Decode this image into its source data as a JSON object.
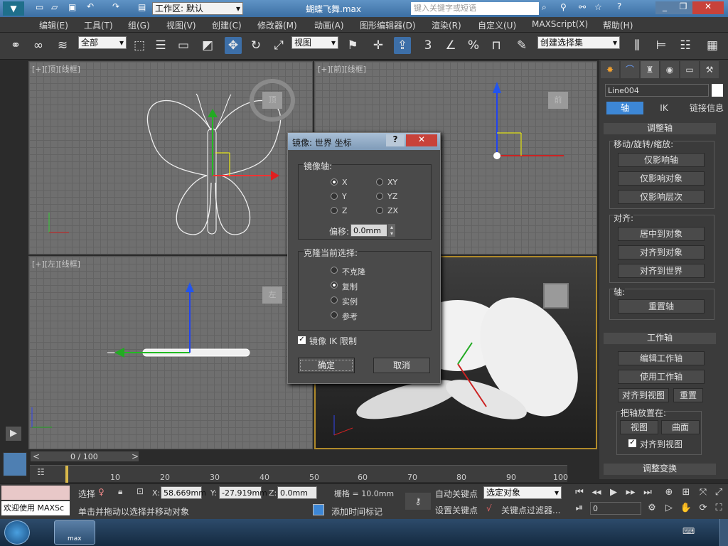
{
  "titlebar": {
    "workspace_label": "工作区: 默认",
    "file_title": "蝴蝶飞舞.max",
    "search_placeholder": "键入关键字或短语"
  },
  "menu": [
    "编辑(E)",
    "工具(T)",
    "组(G)",
    "视图(V)",
    "创建(C)",
    "修改器(M)",
    "动画(A)",
    "图形编辑器(D)",
    "渲染(R)",
    "自定义(U)",
    "MAXScript(X)",
    "帮助(H)"
  ],
  "toolbar": {
    "filter_value": "全部",
    "refcoord_value": "视图",
    "selection_set_value": "创建选择集",
    "snap_label": "3",
    "percent_label": "%"
  },
  "viewports": {
    "top": {
      "label": "[+][顶][线框]",
      "cube": "顶"
    },
    "front": {
      "label": "[+][前][线框]",
      "cube": "前"
    },
    "left": {
      "label": "[+][左][线框]",
      "cube": "左"
    },
    "persp": {
      "label": "",
      "cube": ""
    }
  },
  "command_panel": {
    "object_name": "Line004",
    "tabs": [
      "轴",
      "IK",
      "链接信息"
    ],
    "rollout_adjust": "调整轴",
    "move_group": "移动/旋转/缩放:",
    "btn_affect_pivot": "仅影响轴",
    "btn_affect_object": "仅影响对象",
    "btn_affect_hierarchy": "仅影响层次",
    "align_group": "对齐:",
    "btn_center": "居中到对象",
    "btn_align_object": "对齐到对象",
    "btn_align_world": "对齐到世界",
    "pivot_group": "轴:",
    "btn_reset_pivot": "重置轴",
    "rollout_working": "工作轴",
    "btn_edit_working": "编辑工作轴",
    "btn_use_working": "使用工作轴",
    "btn_align_view": "对齐到视图",
    "btn_reset": "重置",
    "place_group": "把轴放置在:",
    "btn_view": "视图",
    "btn_surface": "曲面",
    "chk_align_view": "对齐到视图",
    "rollout_transform": "调整变换"
  },
  "dialog": {
    "title": "镜像: 世界 坐标",
    "help": "?",
    "axis_group": "镜像轴:",
    "axes": [
      "X",
      "Y",
      "Z",
      "XY",
      "YZ",
      "ZX"
    ],
    "offset_label": "偏移:",
    "offset_value": "0.0mm",
    "clone_group": "克隆当前选择:",
    "clone_opts": [
      "不克隆",
      "复制",
      "实例",
      "参考"
    ],
    "ik_label": "镜像 IK 限制",
    "ok": "确定",
    "cancel": "取消"
  },
  "timeline": {
    "frame": "0 / 100",
    "ticks": [
      "10",
      "20",
      "30",
      "40",
      "50",
      "60",
      "70",
      "80",
      "90",
      "100"
    ]
  },
  "status": {
    "welcome": "欢迎使用 MAXSc",
    "select_label": "选择",
    "x_value": "58.669mm",
    "y_value": "-27.919mm",
    "z_value": "0.0mm",
    "x_label": "X:",
    "y_label": "Y:",
    "z_label": "Z:",
    "grid": "栅格 = 10.0mm",
    "prompt": "单击并拖动以选择并移动对象",
    "add_time_tag": "添加时间标记",
    "autokey": "自动关键点",
    "setkey": "设置关键点",
    "key_filter_value": "选定对象",
    "key_filters": "关键点过滤器...",
    "frame_field": "0"
  },
  "taskbar": {
    "app": "max"
  }
}
